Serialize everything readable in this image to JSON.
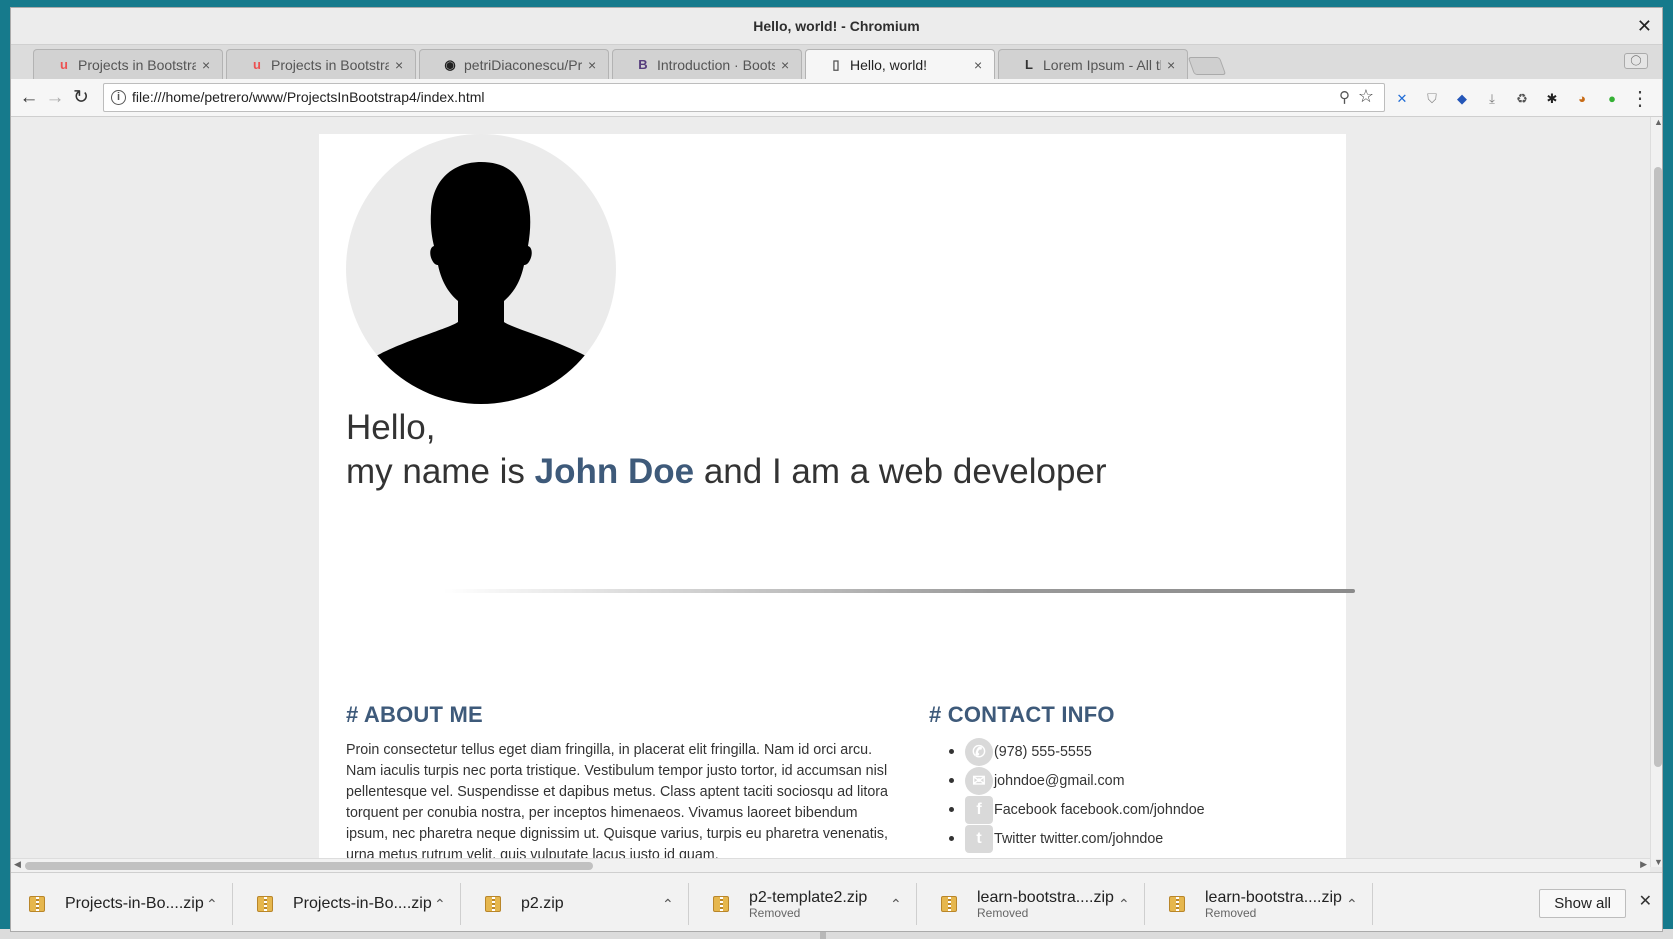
{
  "window": {
    "title": "Hello, world! - Chromium",
    "close_label": "✕"
  },
  "tabs": [
    {
      "label": "Projects in Bootstra",
      "icon": "udemy-icon",
      "glyph": "u",
      "color": "#ec5252"
    },
    {
      "label": "Projects in Bootstra",
      "icon": "udemy-icon",
      "glyph": "u",
      "color": "#ec5252"
    },
    {
      "label": "petriDiaconescu/Pr",
      "icon": "github-icon",
      "glyph": "◉",
      "color": "#222222"
    },
    {
      "label": "Introduction · Boots",
      "icon": "bootstrap-icon",
      "glyph": "B",
      "color": "#563d7c"
    },
    {
      "label": "Hello, world!",
      "icon": "document-icon",
      "glyph": "▯",
      "color": "#555555"
    },
    {
      "label": "Lorem Ipsum - All tl",
      "icon": "lipsum-icon",
      "glyph": "L",
      "color": "#333333"
    }
  ],
  "toolbar": {
    "url": "file:///home/petrero/www/ProjectsInBootstrap4/index.html",
    "extensions": [
      {
        "icon": "extension-x-icon",
        "glyph": "✕",
        "color": "#1e6bd6"
      },
      {
        "icon": "shield-icon",
        "glyph": "⛉",
        "color": "#8a8a8a"
      },
      {
        "icon": "bird-icon",
        "glyph": "◆",
        "color": "#2456b8"
      },
      {
        "icon": "download-icon",
        "glyph": "⤓",
        "color": "#7a7a7a"
      },
      {
        "icon": "recycle-icon",
        "glyph": "♻",
        "color": "#555555"
      },
      {
        "icon": "spider-icon",
        "glyph": "✱",
        "color": "#222222"
      },
      {
        "icon": "fox-icon",
        "glyph": "◕",
        "color": "#c76b16"
      },
      {
        "icon": "green-badge-icon",
        "glyph": "●",
        "color": "#35b135"
      }
    ]
  },
  "page": {
    "greeting": "Hello,",
    "intro_prefix": "my name is ",
    "name": "John Doe",
    "intro_suffix": " and I am a web developer",
    "about": {
      "heading": "# ABOUT ME",
      "text": "Proin consectetur tellus eget diam fringilla, in placerat elit fringilla. Nam id orci arcu. Nam iaculis turpis nec porta tristique. Vestibulum tempor justo tortor, id accumsan nisl pellentesque vel. Suspendisse et dapibus metus. Class aptent taciti sociosqu ad litora torquent per conubia nostra, per inceptos himenaeos. Vivamus laoreet bibendum ipsum, nec pharetra neque dignissim ut. Quisque varius, turpis eu pharetra venenatis, urna metus rutrum velit, quis vulputate lacus justo id quam."
    },
    "contact": {
      "heading": "# CONTACT INFO",
      "items": [
        {
          "icon": "phone-icon",
          "text": "(978) 555-5555"
        },
        {
          "icon": "email-icon",
          "text": "johndoe@gmail.com"
        },
        {
          "icon": "facebook-icon",
          "text": "Facebook facebook.com/johndoe"
        },
        {
          "icon": "twitter-icon",
          "text": "Twitter twitter.com/johndoe"
        }
      ]
    }
  },
  "downloads": {
    "items": [
      {
        "name": "Projects-in-Bo....zip",
        "status": ""
      },
      {
        "name": "Projects-in-Bo....zip",
        "status": ""
      },
      {
        "name": "p2.zip",
        "status": ""
      },
      {
        "name": "p2-template2.zip",
        "status": "Removed"
      },
      {
        "name": "learn-bootstra....zip",
        "status": "Removed"
      },
      {
        "name": "learn-bootstra....zip",
        "status": "Removed"
      }
    ],
    "show_all": "Show all"
  }
}
